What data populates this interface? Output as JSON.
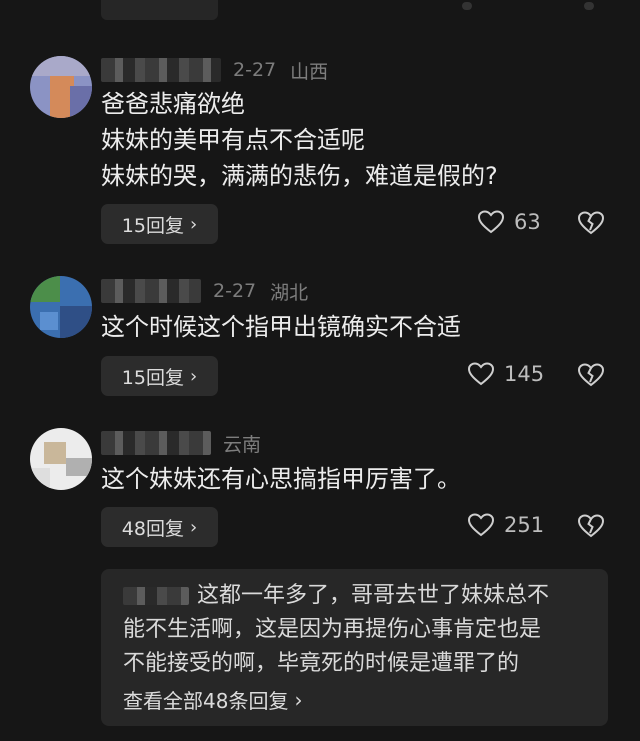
{
  "comments": [
    {
      "date": "2-27",
      "location": "山西",
      "lines": [
        "爸爸悲痛欲绝",
        "妹妹的美甲有点不合适呢",
        "妹妹的哭，满满的悲伤，难道是假的?"
      ],
      "reply_button": "15回复",
      "likes": "63",
      "avatar_colors": [
        "#8b93c4",
        "#d48a5a",
        "#6a6fa8"
      ]
    },
    {
      "date": "2-27",
      "location": "湖北",
      "lines": [
        "这个时候这个指甲出镜确实不合适"
      ],
      "reply_button": "15回复",
      "likes": "145",
      "avatar_colors": [
        "#3b6fb0",
        "#4c8e4a",
        "#2f4f86"
      ]
    },
    {
      "date": "",
      "location": "云南",
      "lines": [
        "这个妹妹还有心思搞指甲厉害了。"
      ],
      "reply_button": "48回复",
      "likes": "251",
      "avatar_colors": [
        "#f2f2f2",
        "#c9b79a",
        "#dedede"
      ]
    }
  ],
  "reply_preview": {
    "lines": [
      "这都一年多了，哥哥去世了妹妹总不",
      "能不生活啊，这是因为再提伤心事肯定也是",
      "不能接受的啊，毕竟死的时候是遭罪了的"
    ],
    "view_all": "查看全部48条回复"
  },
  "icons": {
    "like": "heart-outline-icon",
    "dislike": "broken-heart-icon",
    "chevron": "chevron-right-icon"
  }
}
